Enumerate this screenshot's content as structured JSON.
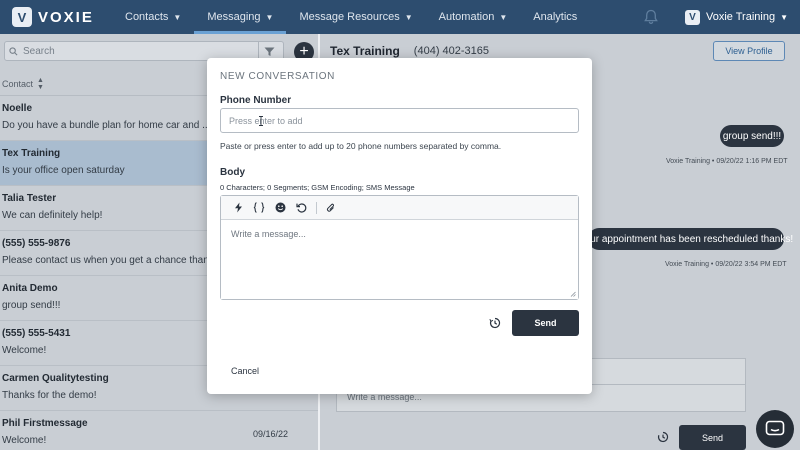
{
  "brand": {
    "letter": "V",
    "name": "VOXIE"
  },
  "nav": {
    "items": [
      {
        "label": "Contacts",
        "has_dropdown": true
      },
      {
        "label": "Messaging",
        "has_dropdown": true,
        "active": true
      },
      {
        "label": "Message Resources",
        "has_dropdown": true
      },
      {
        "label": "Automation",
        "has_dropdown": true
      },
      {
        "label": "Analytics",
        "has_dropdown": false
      }
    ],
    "account": {
      "letter": "V",
      "label": "Voxie Training"
    },
    "icons": {
      "notifications": "bell-icon",
      "dropdown": "chevron-down-icon"
    }
  },
  "sidebar": {
    "search_placeholder": "Search",
    "sort_label": "Contact",
    "contacts": [
      {
        "name": "Noelle",
        "preview": "Do you have a bundle plan for home car and ...",
        "date": ""
      },
      {
        "name": "Tex Training",
        "preview": "Is your office open saturday",
        "date": "",
        "selected": true
      },
      {
        "name": "Talia Tester",
        "preview": "We can definitely help!",
        "date": ""
      },
      {
        "name": "(555) 555-9876",
        "preview": "Please contact us when you get a chance than...",
        "date": ""
      },
      {
        "name": "Anita Demo",
        "preview": "group send!!!",
        "date": ""
      },
      {
        "name": "(555) 555-5431",
        "preview": "Welcome!",
        "date": ""
      },
      {
        "name": "Carmen Qualitytesting",
        "preview": "Thanks for the demo!",
        "date": ""
      },
      {
        "name": "Phil Firstmessage",
        "preview": "Welcome!",
        "date": "09/16/22"
      }
    ]
  },
  "conversation": {
    "name": "Tex Training",
    "phone": "(404) 402-3165",
    "view_profile_label": "View Profile",
    "messages": [
      {
        "text": "group send!!!",
        "meta": "Voxie Training • 09/20/22 1:16 PM EDT"
      },
      {
        "text": "Your appointment has been rescheduled thanks!",
        "meta": "Voxie Training • 09/20/22 3:54 PM EDT"
      }
    ],
    "composer_placeholder": "Write a message...",
    "send_label": "Send"
  },
  "modal": {
    "title": "NEW CONVERSATION",
    "phone_label": "Phone Number",
    "phone_placeholder": "Press enter to add",
    "phone_help": "Paste or press enter to add up to 20 phone numbers separated by comma.",
    "body_label": "Body",
    "body_stats": "0 Characters; 0 Segments; GSM Encoding; SMS Message",
    "body_placeholder": "Write a message...",
    "toolbar_icons": [
      "lightning-icon",
      "braces-icon",
      "emoji-icon",
      "undo-icon",
      "paperclip-icon"
    ],
    "send_label": "Send",
    "cancel_label": "Cancel"
  },
  "colors": {
    "nav_bg": "#2d4d6f",
    "nav_active_underline": "#6aa1d4",
    "dark_button": "#2b3440",
    "selected_row": "#a9bccf",
    "overlay_panel": "#c9ced4"
  }
}
